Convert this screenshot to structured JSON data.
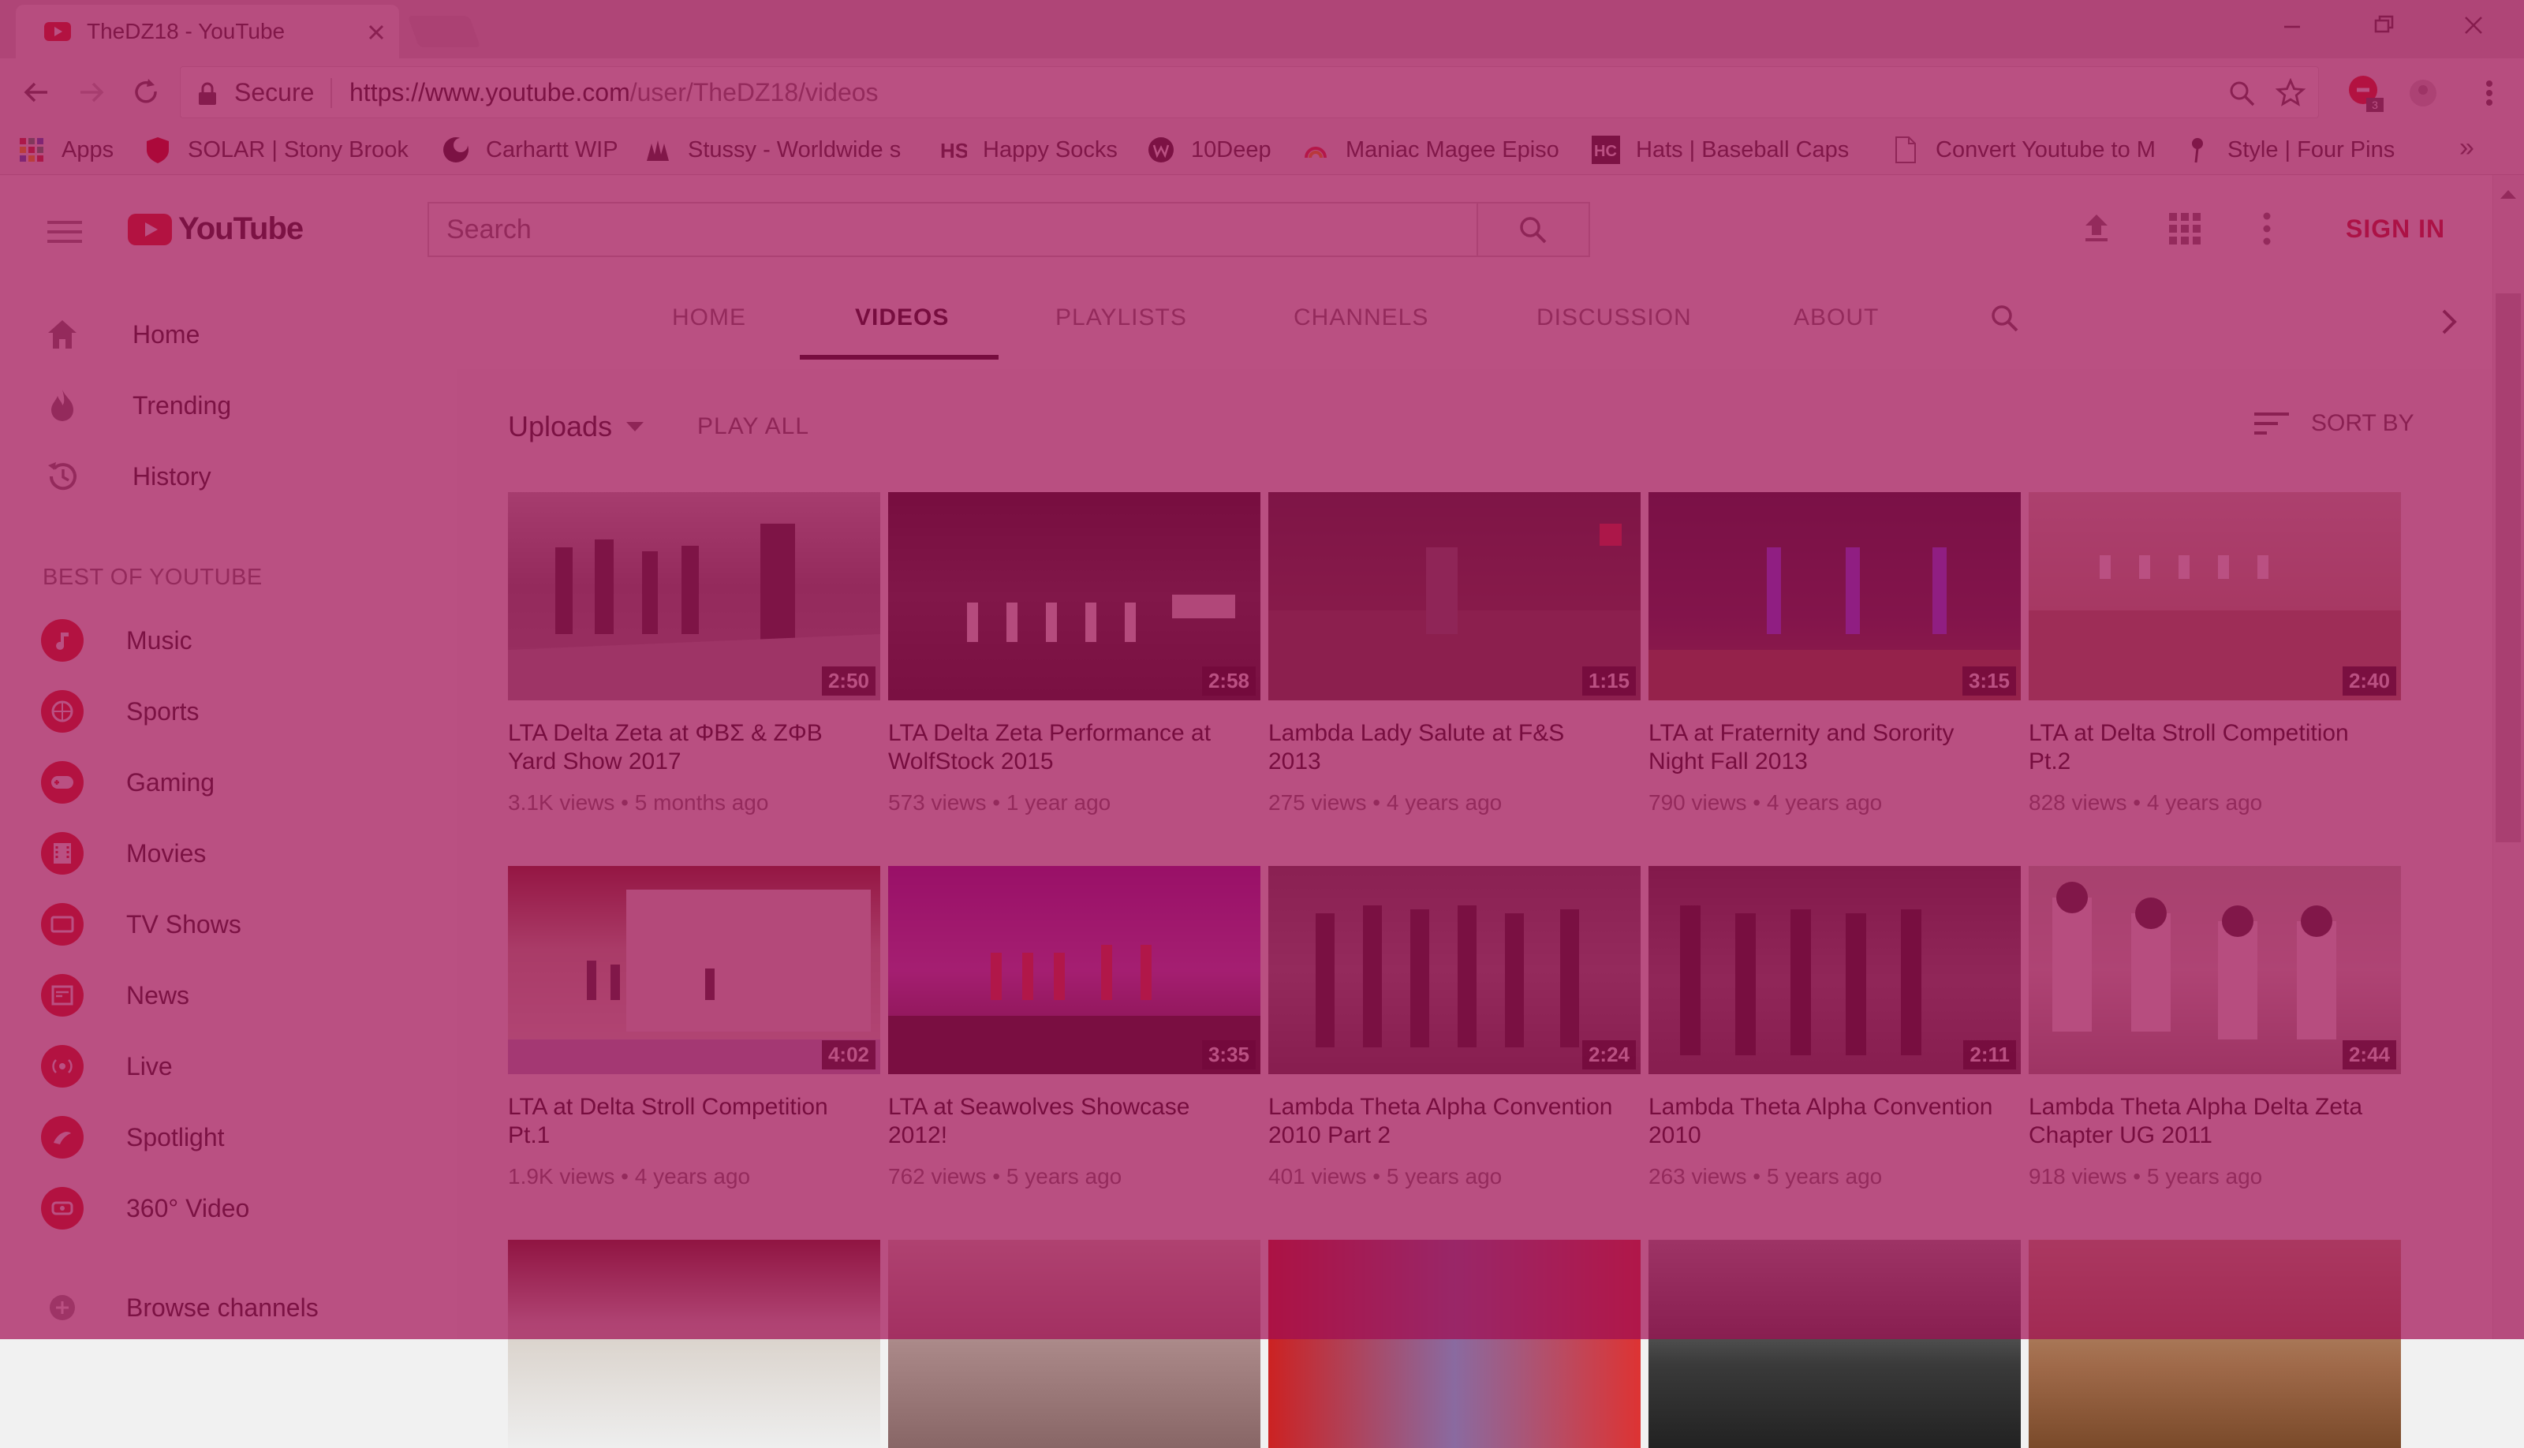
{
  "browser": {
    "tab_title": "TheDZ18 - YouTube",
    "secure_label": "Secure",
    "url_host": "https://www.youtube.com",
    "url_path": "/user/TheDZ18/videos",
    "extension_badge": "3",
    "bookmarks": [
      {
        "label": "Apps",
        "icon": "apps-grid-icon"
      },
      {
        "label": "SOLAR | Stony Brook",
        "icon": "shield-icon"
      },
      {
        "label": "Carhartt WIP",
        "icon": "carhartt-icon"
      },
      {
        "label": "Stussy - Worldwide s",
        "icon": "stussy-icon"
      },
      {
        "label": "Happy Socks",
        "icon": "hs-icon"
      },
      {
        "label": "10Deep",
        "icon": "tendeep-icon"
      },
      {
        "label": "Maniac Magee Episo",
        "icon": "rainbow-icon"
      },
      {
        "label": "Hats | Baseball Caps",
        "icon": "hc-icon"
      },
      {
        "label": "Convert Youtube to M",
        "icon": "page-icon"
      },
      {
        "label": "Style | Four Pins",
        "icon": "pin-icon"
      }
    ],
    "bookmarks_overflow": "»"
  },
  "youtube": {
    "logo_text": "YouTube",
    "search_placeholder": "Search",
    "sign_in": "SIGN IN"
  },
  "sidebar": {
    "primary": [
      {
        "label": "Home",
        "icon": "home-icon"
      },
      {
        "label": "Trending",
        "icon": "flame-icon"
      },
      {
        "label": "History",
        "icon": "history-icon"
      }
    ],
    "section_title": "BEST OF YOUTUBE",
    "best": [
      {
        "label": "Music",
        "icon": "music-icon"
      },
      {
        "label": "Sports",
        "icon": "sports-icon"
      },
      {
        "label": "Gaming",
        "icon": "gaming-icon"
      },
      {
        "label": "Movies",
        "icon": "movies-icon"
      },
      {
        "label": "TV Shows",
        "icon": "tv-icon"
      },
      {
        "label": "News",
        "icon": "news-icon"
      },
      {
        "label": "Live",
        "icon": "live-icon"
      },
      {
        "label": "Spotlight",
        "icon": "spotlight-icon"
      },
      {
        "label": "360° Video",
        "icon": "360-video-icon"
      }
    ],
    "browse": {
      "label": "Browse channels",
      "icon": "add-circle-icon"
    }
  },
  "channel": {
    "tabs": [
      "HOME",
      "VIDEOS",
      "PLAYLISTS",
      "CHANNELS",
      "DISCUSSION",
      "ABOUT"
    ],
    "active_tab": "VIDEOS",
    "uploads_label": "Uploads",
    "play_all": "PLAY ALL",
    "sort_by": "SORT BY"
  },
  "videos": [
    {
      "title": "LTA Delta Zeta at ΦΒΣ & ΖΦΒ Yard Show 2017",
      "views": "3.1K views",
      "age": "5 months ago",
      "duration": "2:50"
    },
    {
      "title": "LTA Delta Zeta Performance at WolfStock 2015",
      "views": "573 views",
      "age": "1 year ago",
      "duration": "2:58"
    },
    {
      "title": "Lambda Lady Salute at F&S 2013",
      "views": "275 views",
      "age": "4 years ago",
      "duration": "1:15"
    },
    {
      "title": "LTA at Fraternity and Sorority Night Fall 2013",
      "views": "790 views",
      "age": "4 years ago",
      "duration": "3:15"
    },
    {
      "title": "LTA at Delta Stroll Competition Pt.2",
      "views": "828 views",
      "age": "4 years ago",
      "duration": "2:40"
    },
    {
      "title": "LTA at Delta Stroll Competition Pt.1",
      "views": "1.9K views",
      "age": "4 years ago",
      "duration": "4:02"
    },
    {
      "title": "LTA at Seawolves Showcase 2012!",
      "views": "762 views",
      "age": "5 years ago",
      "duration": "3:35"
    },
    {
      "title": "Lambda Theta Alpha Convention 2010 Part 2",
      "views": "401 views",
      "age": "5 years ago",
      "duration": "2:24"
    },
    {
      "title": "Lambda Theta Alpha Convention 2010",
      "views": "263 views",
      "age": "5 years ago",
      "duration": "2:11"
    },
    {
      "title": "Lambda Theta Alpha Delta Zeta Chapter UG 2011",
      "views": "918 views",
      "age": "5 years ago",
      "duration": "2:44"
    },
    {
      "title": "",
      "views": "",
      "age": "",
      "duration": ""
    },
    {
      "title": "",
      "views": "",
      "age": "",
      "duration": ""
    },
    {
      "title": "",
      "views": "",
      "age": "",
      "duration": ""
    },
    {
      "title": "",
      "views": "",
      "age": "",
      "duration": ""
    },
    {
      "title": "",
      "views": "",
      "age": "",
      "duration": ""
    }
  ],
  "colors": {
    "overlay": "#a00c52",
    "youtube_red": "#e62117",
    "sign_in_red": "#cc2229"
  }
}
